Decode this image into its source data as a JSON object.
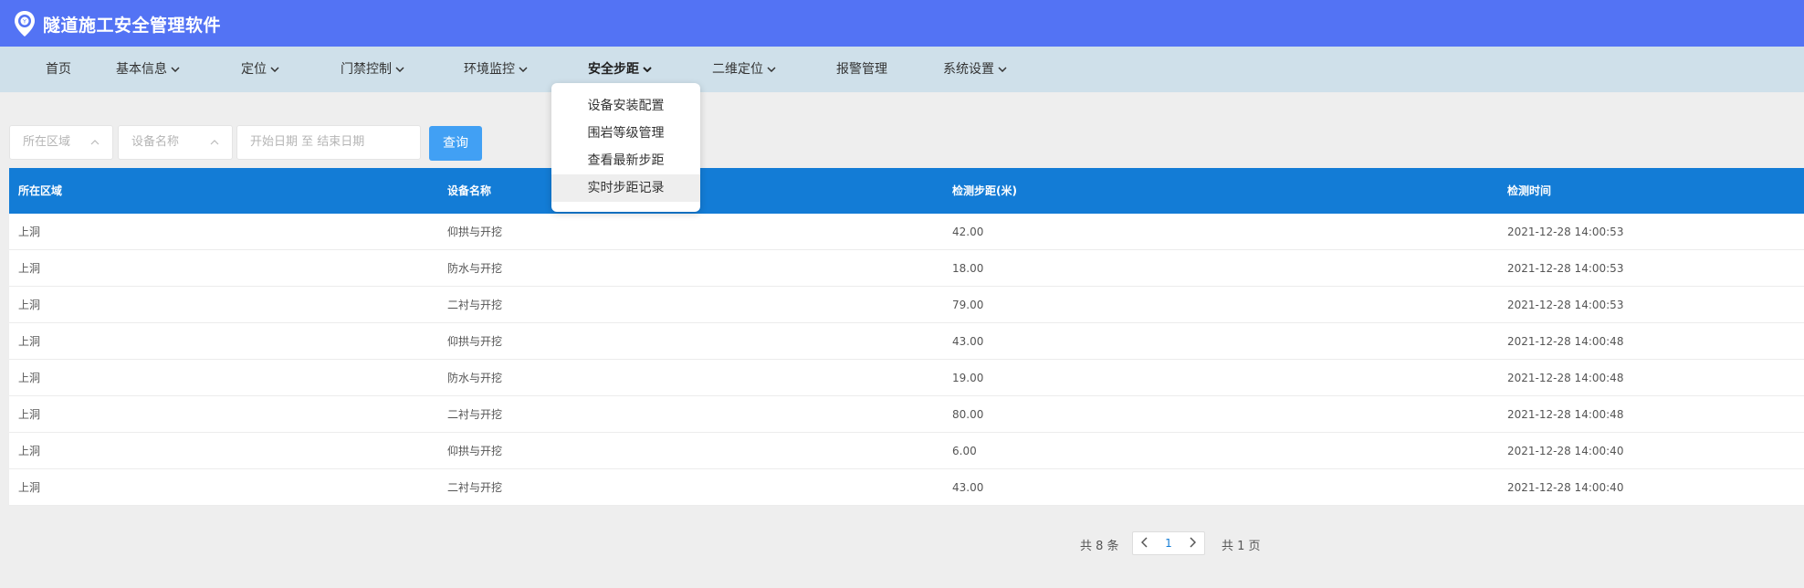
{
  "app": {
    "title": "隧道施工安全管理软件",
    "logo_icon": "shield-location-icon"
  },
  "nav": [
    {
      "label": "首页",
      "has_menu": false
    },
    {
      "label": "基本信息",
      "has_menu": true
    },
    {
      "label": "定位",
      "has_menu": true
    },
    {
      "label": "门禁控制",
      "has_menu": true
    },
    {
      "label": "环境监控",
      "has_menu": true
    },
    {
      "label": "安全步距",
      "has_menu": true,
      "active": true
    },
    {
      "label": "二维定位",
      "has_menu": true
    },
    {
      "label": "报警管理",
      "has_menu": false
    },
    {
      "label": "系统设置",
      "has_menu": true
    }
  ],
  "dropdown": {
    "items": [
      "设备安装配置",
      "围岩等级管理",
      "查看最新步距",
      "实时步距记录"
    ],
    "selected_index": 3
  },
  "filters": {
    "area_placeholder": "所在区域",
    "device_placeholder": "设备名称",
    "date_placeholder": "开始日期 至 结束日期",
    "query_label": "查询"
  },
  "table": {
    "headers": [
      "所在区域",
      "设备名称",
      "检测步距(米)",
      "检测时间"
    ],
    "rows": [
      [
        "上洞",
        "仰拱与开挖",
        "42.00",
        "2021-12-28 14:00:53"
      ],
      [
        "上洞",
        "防水与开挖",
        "18.00",
        "2021-12-28 14:00:53"
      ],
      [
        "上洞",
        "二衬与开挖",
        "79.00",
        "2021-12-28 14:00:53"
      ],
      [
        "上洞",
        "仰拱与开挖",
        "43.00",
        "2021-12-28 14:00:48"
      ],
      [
        "上洞",
        "防水与开挖",
        "19.00",
        "2021-12-28 14:00:48"
      ],
      [
        "上洞",
        "二衬与开挖",
        "80.00",
        "2021-12-28 14:00:48"
      ],
      [
        "上洞",
        "仰拱与开挖",
        "6.00",
        "2021-12-28 14:00:40"
      ],
      [
        "上洞",
        "二衬与开挖",
        "43.00",
        "2021-12-28 14:00:40"
      ]
    ]
  },
  "pagination": {
    "total_label": "共 8 条",
    "current_page": "1",
    "pages_label": "共 1 页"
  },
  "colors": {
    "header_bg": "#5373f4",
    "nav_bg": "#cfe0ea",
    "table_header_bg": "#137cd6",
    "query_button": "#41a0f4"
  }
}
